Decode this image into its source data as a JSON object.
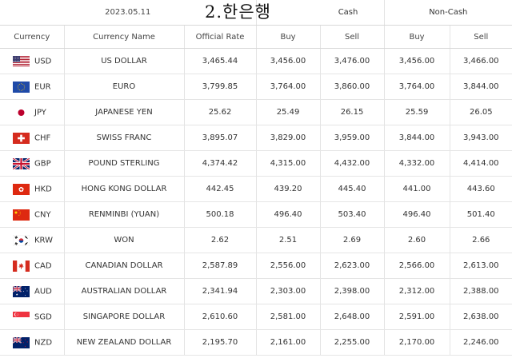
{
  "header": {
    "date": "2023.05.11",
    "overlay_title": "2.한은행",
    "cash_label": "Cash",
    "noncash_label": "Non-Cash"
  },
  "columns": {
    "currency": "Currency",
    "name": "Currency Name",
    "official": "Official Rate",
    "cash_buy": "Buy",
    "cash_sell": "Sell",
    "noncash_buy": "Buy",
    "noncash_sell": "Sell"
  },
  "rows": [
    {
      "code": "USD",
      "flag": "us-flag-icon",
      "name": "US DOLLAR",
      "official": "3,465.44",
      "cash_buy": "3,456.00",
      "cash_sell": "3,476.00",
      "nc_buy": "3,456.00",
      "nc_sell": "3,466.00"
    },
    {
      "code": "EUR",
      "flag": "eu-flag-icon",
      "name": "EURO",
      "official": "3,799.85",
      "cash_buy": "3,764.00",
      "cash_sell": "3,860.00",
      "nc_buy": "3,764.00",
      "nc_sell": "3,844.00"
    },
    {
      "code": "JPY",
      "flag": "jp-flag-icon",
      "name": "JAPANESE YEN",
      "official": "25.62",
      "cash_buy": "25.49",
      "cash_sell": "26.15",
      "nc_buy": "25.59",
      "nc_sell": "26.05"
    },
    {
      "code": "CHF",
      "flag": "ch-flag-icon",
      "name": "SWISS FRANC",
      "official": "3,895.07",
      "cash_buy": "3,829.00",
      "cash_sell": "3,959.00",
      "nc_buy": "3,844.00",
      "nc_sell": "3,943.00"
    },
    {
      "code": "GBP",
      "flag": "gb-flag-icon",
      "name": "POUND STERLING",
      "official": "4,374.42",
      "cash_buy": "4,315.00",
      "cash_sell": "4,432.00",
      "nc_buy": "4,332.00",
      "nc_sell": "4,414.00"
    },
    {
      "code": "HKD",
      "flag": "hk-flag-icon",
      "name": "HONG KONG DOLLAR",
      "official": "442.45",
      "cash_buy": "439.20",
      "cash_sell": "445.40",
      "nc_buy": "441.00",
      "nc_sell": "443.60"
    },
    {
      "code": "CNY",
      "flag": "cn-flag-icon",
      "name": "RENMINBI (YUAN)",
      "official": "500.18",
      "cash_buy": "496.40",
      "cash_sell": "503.40",
      "nc_buy": "496.40",
      "nc_sell": "501.40"
    },
    {
      "code": "KRW",
      "flag": "kr-flag-icon",
      "name": "WON",
      "official": "2.62",
      "cash_buy": "2.51",
      "cash_sell": "2.69",
      "nc_buy": "2.60",
      "nc_sell": "2.66"
    },
    {
      "code": "CAD",
      "flag": "ca-flag-icon",
      "name": "CANADIAN DOLLAR",
      "official": "2,587.89",
      "cash_buy": "2,556.00",
      "cash_sell": "2,623.00",
      "nc_buy": "2,566.00",
      "nc_sell": "2,613.00"
    },
    {
      "code": "AUD",
      "flag": "au-flag-icon",
      "name": "AUSTRALIAN DOLLAR",
      "official": "2,341.94",
      "cash_buy": "2,303.00",
      "cash_sell": "2,398.00",
      "nc_buy": "2,312.00",
      "nc_sell": "2,388.00"
    },
    {
      "code": "SGD",
      "flag": "sg-flag-icon",
      "name": "SINGAPORE DOLLAR",
      "official": "2,610.60",
      "cash_buy": "2,581.00",
      "cash_sell": "2,648.00",
      "nc_buy": "2,591.00",
      "nc_sell": "2,638.00"
    },
    {
      "code": "NZD",
      "flag": "nz-flag-icon",
      "name": "NEW ZEALAND DOLLAR",
      "official": "2,195.70",
      "cash_buy": "2,161.00",
      "cash_sell": "2,255.00",
      "nc_buy": "2,170.00",
      "nc_sell": "2,246.00"
    }
  ]
}
